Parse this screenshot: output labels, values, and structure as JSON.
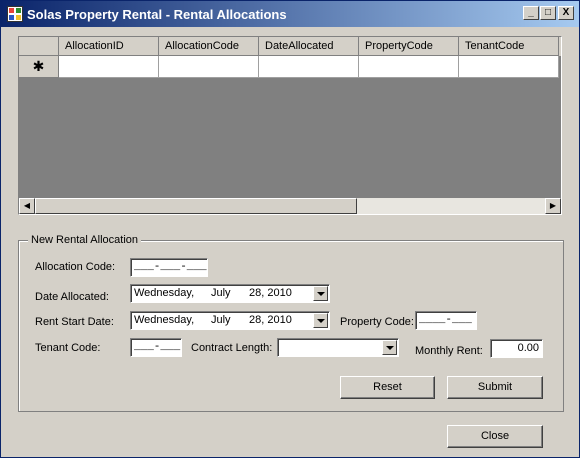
{
  "window": {
    "title": "Solas Property Rental - Rental Allocations",
    "controls": {
      "minimize": "_",
      "maximize": "□",
      "close": "X"
    }
  },
  "grid": {
    "columns": [
      "AllocationID",
      "AllocationCode",
      "DateAllocated",
      "PropertyCode",
      "TenantCode"
    ],
    "new_row_marker": "✱",
    "scroll_left": "◀",
    "scroll_right": "▶"
  },
  "form": {
    "group_title": "New Rental Allocation",
    "allocation_code": {
      "label": "Allocation Code:",
      "value": "___-___-___"
    },
    "date_allocated": {
      "label": "Date Allocated:",
      "day": "Wednesday,",
      "month": "July",
      "date": "28, 2010"
    },
    "rent_start_date": {
      "label": "Rent Start Date:",
      "day": "Wednesday,",
      "month": "July",
      "date": "28, 2010"
    },
    "property_code": {
      "label": "Property Code:",
      "value": "____-___"
    },
    "tenant_code": {
      "label": "Tenant Code:",
      "value": "___-___"
    },
    "contract_length": {
      "label": "Contract Length:",
      "value": ""
    },
    "monthly_rent": {
      "label": "Monthly Rent:",
      "value": "0.00"
    },
    "reset_label": "Reset",
    "submit_label": "Submit"
  },
  "footer": {
    "close_label": "Close"
  }
}
